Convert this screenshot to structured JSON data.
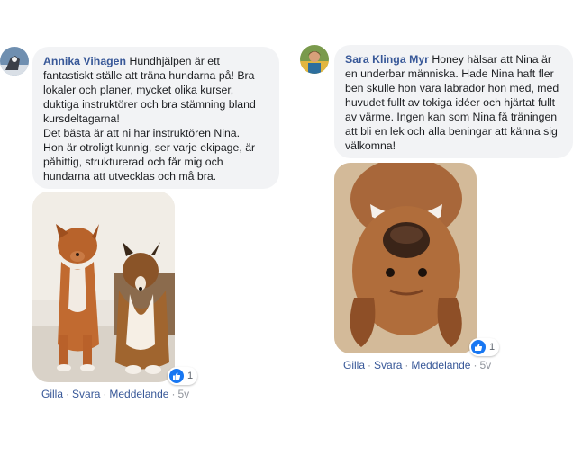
{
  "comments": [
    {
      "author": "Annika Vihagen",
      "text_lines": [
        "Hundhjälpen är ett",
        "fantastiskt ställe att träna hundarna på! Bra",
        "lokaler och planer, mycket olika kurser,",
        "duktiga instruktörer och bra stämning bland",
        "kursdeltagarna!",
        "Det bästa är att ni har instruktören Nina.",
        "Hon är otroligt kunnig, ser varje ekipage, är",
        "påhittig, strukturerad och får mig och",
        "hundarna att utvecklas och må bra."
      ],
      "reaction_count": "1",
      "actions": {
        "like": "Gilla",
        "reply": "Svara",
        "message": "Meddelande",
        "time": "5v"
      }
    },
    {
      "author": "Sara Klinga Myr",
      "text_lines": [
        "Honey hälsar att Nina är",
        "en underbar människa. Hade Nina haft fler",
        "ben skulle hon vara labrador hon med, med",
        "huvudet fullt av tokiga idéer och hjärtat fullt",
        "av värme. Ingen kan som Nina få träningen",
        "att bli en lek och alla beningar att känna sig",
        "välkomna!"
      ],
      "reaction_count": "1",
      "actions": {
        "like": "Gilla",
        "reply": "Svara",
        "message": "Meddelande",
        "time": "5v"
      }
    }
  ],
  "colors": {
    "link": "#385898",
    "bubble": "#f2f3f5",
    "like_badge": "#1877f2",
    "meta": "#90949c"
  }
}
